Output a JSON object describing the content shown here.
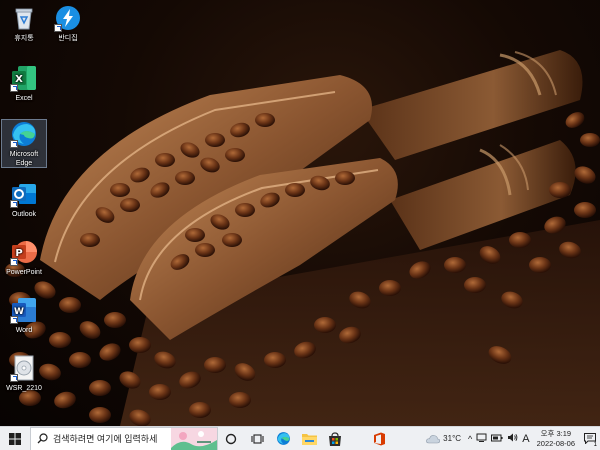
{
  "desktop": {
    "icons": [
      {
        "label": "휴지통"
      },
      {
        "label": "반디집"
      },
      {
        "label": "Excel"
      },
      {
        "label": "Microsoft Edge"
      },
      {
        "label": "Outlook"
      },
      {
        "label": "PowerPoint"
      },
      {
        "label": "Word"
      },
      {
        "label": "WSR_2210"
      }
    ]
  },
  "taskbar": {
    "search_placeholder": "검색하려면 여기에 입력하세",
    "weather": {
      "temp": "31°C",
      "icon": "cloud-icon"
    },
    "ime_label": "A",
    "clock": {
      "time": "오후 3:19",
      "date": "2022-08-06"
    },
    "notification_count": "1",
    "pinned": [
      "task-view-icon",
      "edge-icon",
      "file-explorer-icon",
      "store-icon",
      "office-icon"
    ]
  },
  "colors": {
    "taskbar_bg": "#eef0f3",
    "edge_blue": "#0c7dd6",
    "office_red": "#d83b01",
    "excel_green": "#107c41",
    "word_blue": "#185abd",
    "outlook_blue": "#0f6cbd",
    "ppt_orange": "#c43e1c"
  }
}
